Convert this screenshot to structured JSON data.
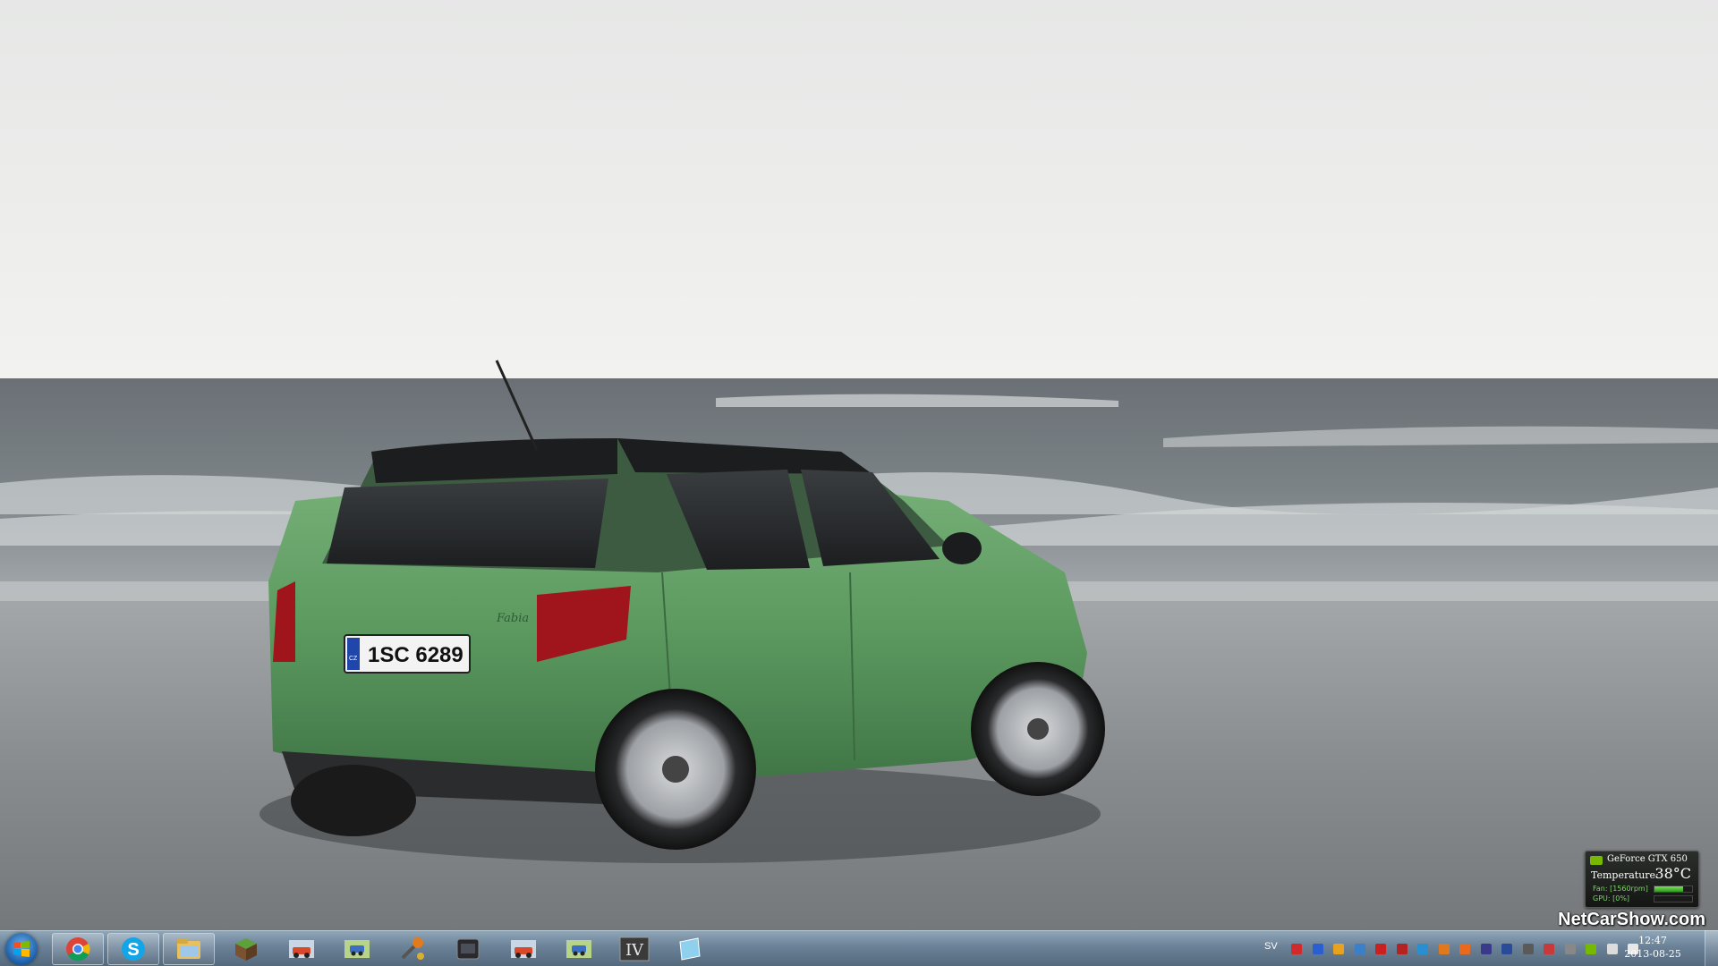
{
  "wallpaper": {
    "description_icon": "car-wallpaper",
    "license_plate": "1SC 6289",
    "plate_country": "CZ",
    "car_badge": "Fabia",
    "colors": {
      "sky": "#ebecea",
      "sea": "#6c7377",
      "ground": "#8e9193",
      "car": "#5a9a5e"
    }
  },
  "gadget": {
    "gpu_name": "GeForce GTX 650",
    "temperature_label": "Temperature:",
    "temperature_value": "38°C",
    "fan_label": "Fan: [1560rpm]",
    "gpu_label": "GPU: [0%]",
    "fan_level": 0.75,
    "gpu_level": 0.0
  },
  "watermark": "NetCarShow.com",
  "taskbar": {
    "start_icon": "windows-logo-icon",
    "pinned": [
      {
        "name": "chrome-icon"
      },
      {
        "name": "skype-icon"
      },
      {
        "name": "file-explorer-icon"
      }
    ],
    "apps": [
      {
        "name": "minecraft-icon"
      },
      {
        "name": "race-car-game-icon"
      },
      {
        "name": "car-map-game-icon"
      },
      {
        "name": "tools-icon"
      },
      {
        "name": "video-player-icon"
      },
      {
        "name": "race-car-game-icon-2"
      },
      {
        "name": "car-map-game-icon-2"
      },
      {
        "name": "gta-iv-icon"
      },
      {
        "name": "window-app-icon"
      }
    ],
    "tray": {
      "language": "SV",
      "icons": [
        "red-app-icon",
        "bluetooth-icon",
        "chrome-tray-icon",
        "network-share-icon",
        "adobe-icon",
        "antivirus-icon",
        "security-icon",
        "orange-app-icon",
        "firefox-icon",
        "monitor-icon",
        "display-icon",
        "media-icon",
        "flag-icon",
        "tools-tray-icon",
        "nvidia-icon",
        "network-icon",
        "volume-icon"
      ]
    },
    "clock": {
      "time": "12:47",
      "date": "2013-08-25"
    }
  }
}
